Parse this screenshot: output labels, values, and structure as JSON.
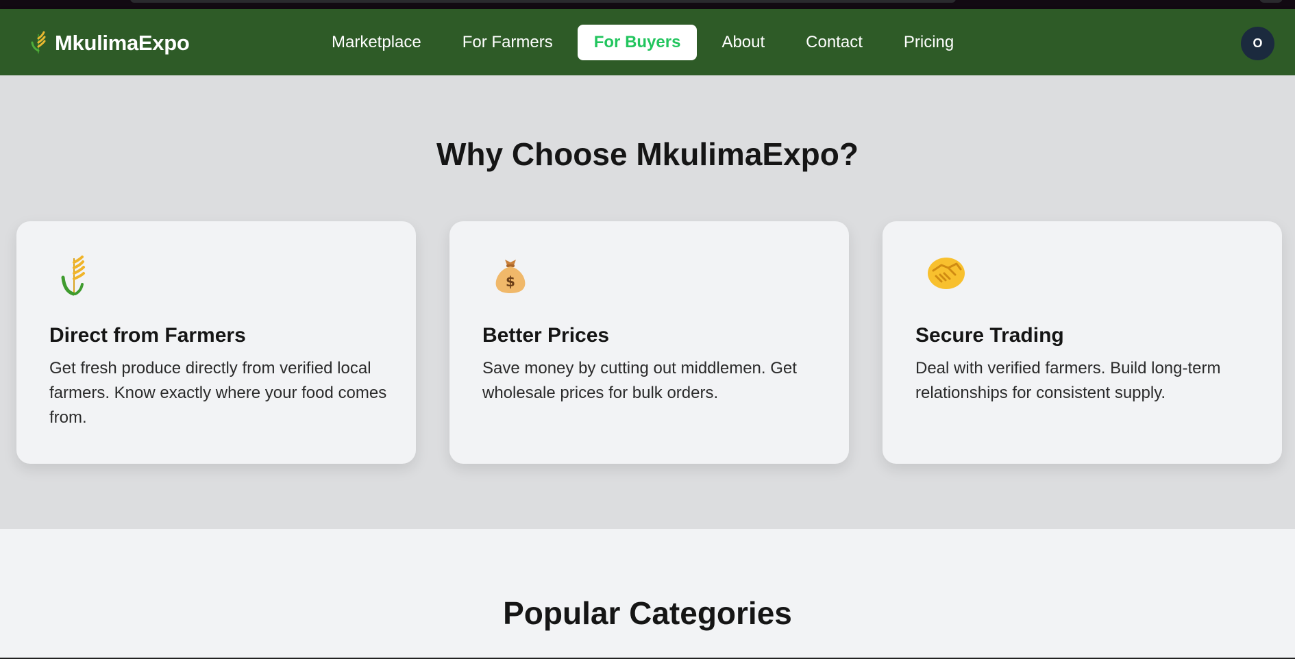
{
  "brand": {
    "name": "MkulimaExpo",
    "icon": "wheat-icon"
  },
  "nav": {
    "links": [
      {
        "label": "Marketplace"
      },
      {
        "label": "For Farmers"
      },
      {
        "label": "For Buyers",
        "active": true
      },
      {
        "label": "About"
      },
      {
        "label": "Contact"
      },
      {
        "label": "Pricing"
      }
    ],
    "avatar_initial": "O"
  },
  "why": {
    "title": "Why Choose MkulimaExpo?",
    "cards": [
      {
        "icon": "wheat-icon",
        "title": "Direct from Farmers",
        "text": "Get fresh produce directly from verified local farmers. Know exactly where your food comes from."
      },
      {
        "icon": "money-bag-icon",
        "title": "Better Prices",
        "text": "Save money by cutting out middlemen. Get wholesale prices for bulk orders."
      },
      {
        "icon": "handshake-icon",
        "title": "Secure Trading",
        "text": "Deal with verified farmers. Build long-term relationships for consistent supply."
      }
    ]
  },
  "popular": {
    "title": "Popular Categories"
  },
  "colors": {
    "navbar": "#2e5b27",
    "active_link_text": "#22c55e",
    "section_bg": "#dcdddf",
    "card_bg": "#f2f3f5"
  }
}
